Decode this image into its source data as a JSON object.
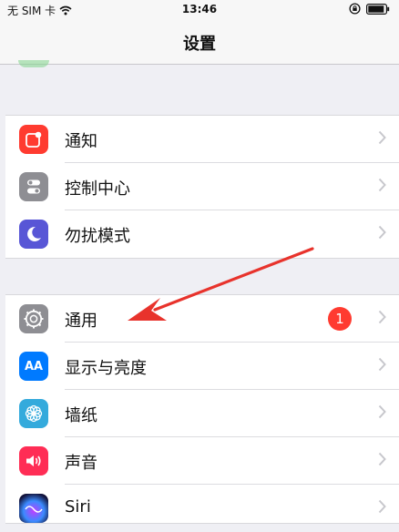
{
  "status_bar": {
    "carrier": "无 SIM 卡",
    "time": "13:46",
    "wifi_icon": "wifi-icon",
    "lock_icon": "orientation-lock-icon",
    "battery_icon": "battery-icon"
  },
  "nav": {
    "title": "设置"
  },
  "group1": [
    {
      "label": "通知",
      "icon": "notifications-icon",
      "color": "#ff3b30"
    },
    {
      "label": "控制中心",
      "icon": "control-center-icon",
      "color": "#8e8e93"
    },
    {
      "label": "勿扰模式",
      "icon": "do-not-disturb-icon",
      "color": "#5856d6"
    }
  ],
  "group2": [
    {
      "label": "通用",
      "icon": "gear-icon",
      "color": "#8e8e93",
      "badge": "1"
    },
    {
      "label": "显示与亮度",
      "icon": "display-brightness-icon",
      "color": "#007aff",
      "glyph": "AA"
    },
    {
      "label": "墙纸",
      "icon": "wallpaper-icon",
      "color": "#34aadc"
    },
    {
      "label": "声音",
      "icon": "sound-icon",
      "color": "#ff2d55"
    },
    {
      "label": "Siri",
      "icon": "siri-icon",
      "color": "#1c1c5e"
    }
  ],
  "annotation": {
    "arrow_icon": "red-arrow-pointer"
  }
}
